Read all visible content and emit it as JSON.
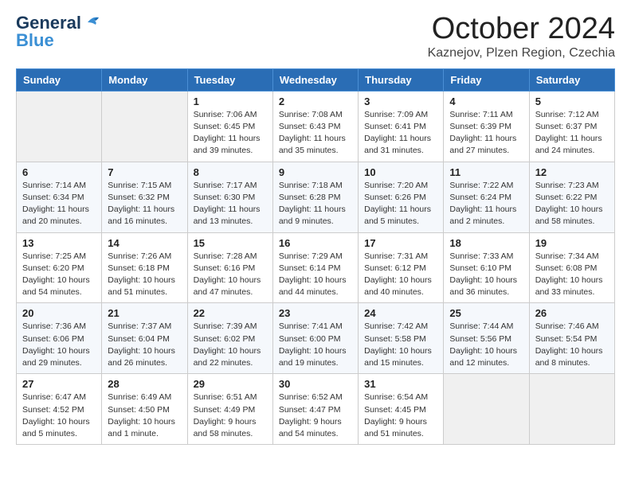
{
  "logo": {
    "line1": "General",
    "line2": "Blue"
  },
  "header": {
    "month": "October 2024",
    "location": "Kaznejov, Plzen Region, Czechia"
  },
  "weekdays": [
    "Sunday",
    "Monday",
    "Tuesday",
    "Wednesday",
    "Thursday",
    "Friday",
    "Saturday"
  ],
  "weeks": [
    [
      {
        "day": "",
        "info": ""
      },
      {
        "day": "",
        "info": ""
      },
      {
        "day": "1",
        "info": "Sunrise: 7:06 AM\nSunset: 6:45 PM\nDaylight: 11 hours and 39 minutes."
      },
      {
        "day": "2",
        "info": "Sunrise: 7:08 AM\nSunset: 6:43 PM\nDaylight: 11 hours and 35 minutes."
      },
      {
        "day": "3",
        "info": "Sunrise: 7:09 AM\nSunset: 6:41 PM\nDaylight: 11 hours and 31 minutes."
      },
      {
        "day": "4",
        "info": "Sunrise: 7:11 AM\nSunset: 6:39 PM\nDaylight: 11 hours and 27 minutes."
      },
      {
        "day": "5",
        "info": "Sunrise: 7:12 AM\nSunset: 6:37 PM\nDaylight: 11 hours and 24 minutes."
      }
    ],
    [
      {
        "day": "6",
        "info": "Sunrise: 7:14 AM\nSunset: 6:34 PM\nDaylight: 11 hours and 20 minutes."
      },
      {
        "day": "7",
        "info": "Sunrise: 7:15 AM\nSunset: 6:32 PM\nDaylight: 11 hours and 16 minutes."
      },
      {
        "day": "8",
        "info": "Sunrise: 7:17 AM\nSunset: 6:30 PM\nDaylight: 11 hours and 13 minutes."
      },
      {
        "day": "9",
        "info": "Sunrise: 7:18 AM\nSunset: 6:28 PM\nDaylight: 11 hours and 9 minutes."
      },
      {
        "day": "10",
        "info": "Sunrise: 7:20 AM\nSunset: 6:26 PM\nDaylight: 11 hours and 5 minutes."
      },
      {
        "day": "11",
        "info": "Sunrise: 7:22 AM\nSunset: 6:24 PM\nDaylight: 11 hours and 2 minutes."
      },
      {
        "day": "12",
        "info": "Sunrise: 7:23 AM\nSunset: 6:22 PM\nDaylight: 10 hours and 58 minutes."
      }
    ],
    [
      {
        "day": "13",
        "info": "Sunrise: 7:25 AM\nSunset: 6:20 PM\nDaylight: 10 hours and 54 minutes."
      },
      {
        "day": "14",
        "info": "Sunrise: 7:26 AM\nSunset: 6:18 PM\nDaylight: 10 hours and 51 minutes."
      },
      {
        "day": "15",
        "info": "Sunrise: 7:28 AM\nSunset: 6:16 PM\nDaylight: 10 hours and 47 minutes."
      },
      {
        "day": "16",
        "info": "Sunrise: 7:29 AM\nSunset: 6:14 PM\nDaylight: 10 hours and 44 minutes."
      },
      {
        "day": "17",
        "info": "Sunrise: 7:31 AM\nSunset: 6:12 PM\nDaylight: 10 hours and 40 minutes."
      },
      {
        "day": "18",
        "info": "Sunrise: 7:33 AM\nSunset: 6:10 PM\nDaylight: 10 hours and 36 minutes."
      },
      {
        "day": "19",
        "info": "Sunrise: 7:34 AM\nSunset: 6:08 PM\nDaylight: 10 hours and 33 minutes."
      }
    ],
    [
      {
        "day": "20",
        "info": "Sunrise: 7:36 AM\nSunset: 6:06 PM\nDaylight: 10 hours and 29 minutes."
      },
      {
        "day": "21",
        "info": "Sunrise: 7:37 AM\nSunset: 6:04 PM\nDaylight: 10 hours and 26 minutes."
      },
      {
        "day": "22",
        "info": "Sunrise: 7:39 AM\nSunset: 6:02 PM\nDaylight: 10 hours and 22 minutes."
      },
      {
        "day": "23",
        "info": "Sunrise: 7:41 AM\nSunset: 6:00 PM\nDaylight: 10 hours and 19 minutes."
      },
      {
        "day": "24",
        "info": "Sunrise: 7:42 AM\nSunset: 5:58 PM\nDaylight: 10 hours and 15 minutes."
      },
      {
        "day": "25",
        "info": "Sunrise: 7:44 AM\nSunset: 5:56 PM\nDaylight: 10 hours and 12 minutes."
      },
      {
        "day": "26",
        "info": "Sunrise: 7:46 AM\nSunset: 5:54 PM\nDaylight: 10 hours and 8 minutes."
      }
    ],
    [
      {
        "day": "27",
        "info": "Sunrise: 6:47 AM\nSunset: 4:52 PM\nDaylight: 10 hours and 5 minutes."
      },
      {
        "day": "28",
        "info": "Sunrise: 6:49 AM\nSunset: 4:50 PM\nDaylight: 10 hours and 1 minute."
      },
      {
        "day": "29",
        "info": "Sunrise: 6:51 AM\nSunset: 4:49 PM\nDaylight: 9 hours and 58 minutes."
      },
      {
        "day": "30",
        "info": "Sunrise: 6:52 AM\nSunset: 4:47 PM\nDaylight: 9 hours and 54 minutes."
      },
      {
        "day": "31",
        "info": "Sunrise: 6:54 AM\nSunset: 4:45 PM\nDaylight: 9 hours and 51 minutes."
      },
      {
        "day": "",
        "info": ""
      },
      {
        "day": "",
        "info": ""
      }
    ]
  ]
}
